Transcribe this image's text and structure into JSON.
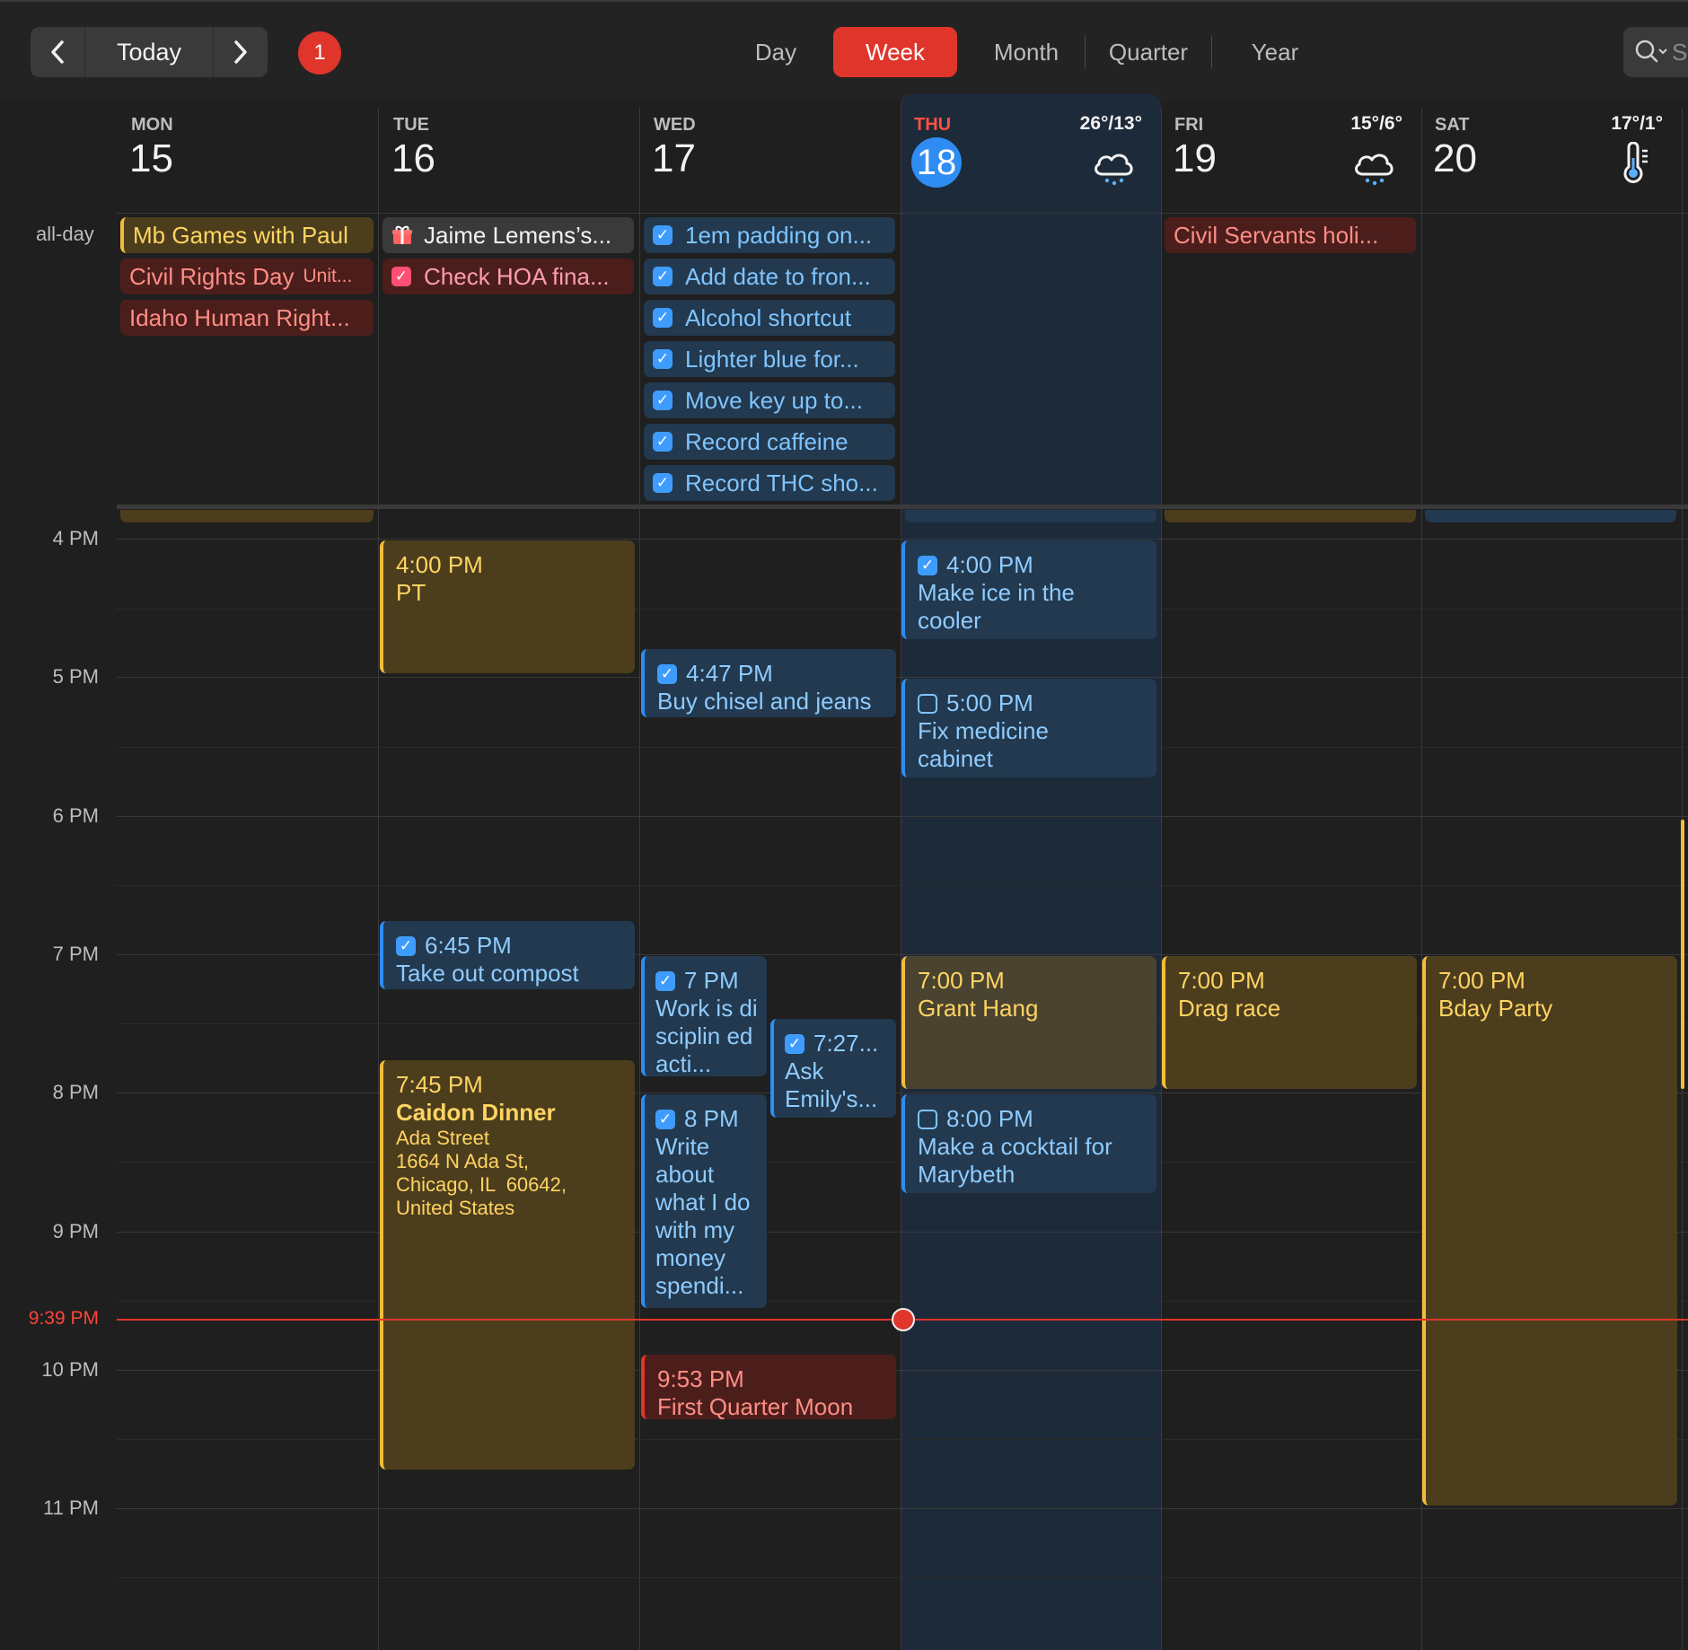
{
  "toolbar": {
    "today_label": "Today",
    "badge_count": "1",
    "views": [
      "Day",
      "Week",
      "Month",
      "Quarter",
      "Year"
    ],
    "active_view": "Week",
    "search_placeholder": "S"
  },
  "days": [
    {
      "dow": "MON",
      "num": "15",
      "temp": ""
    },
    {
      "dow": "TUE",
      "num": "16",
      "temp": ""
    },
    {
      "dow": "WED",
      "num": "17",
      "temp": ""
    },
    {
      "dow": "THU",
      "num": "18",
      "temp": "26°/13°",
      "weather_icon": "cloud-snow-icon"
    },
    {
      "dow": "FRI",
      "num": "19",
      "temp": "15°/6°",
      "weather_icon": "cloud-snow-icon"
    },
    {
      "dow": "SAT",
      "num": "20",
      "temp": "17°/1°",
      "weather_icon": "thermometer-icon"
    }
  ],
  "allday_label": "all-day",
  "allday": {
    "mon": [
      {
        "title": "Mb Games with Paul"
      },
      {
        "title": "Civil Rights Day",
        "sub": "Unit..."
      },
      {
        "title": "Idaho Human Right..."
      }
    ],
    "tue": [
      {
        "title": "Jaime Lemens’s..."
      },
      {
        "title": "Check HOA fina..."
      }
    ],
    "wed": [
      {
        "title": "1em padding on..."
      },
      {
        "title": "Add date to fron..."
      },
      {
        "title": "Alcohol shortcut"
      },
      {
        "title": "Lighter blue for..."
      },
      {
        "title": "Move key up to..."
      },
      {
        "title": "Record caffeine"
      },
      {
        "title": "Record THC sho..."
      }
    ],
    "fri": [
      {
        "title": "Civil Servants holi..."
      }
    ]
  },
  "hours": [
    "4 PM",
    "5 PM",
    "6 PM",
    "7 PM",
    "8 PM",
    "9 PM",
    "10 PM",
    "11 PM"
  ],
  "now_label": "9:39 PM",
  "events": {
    "pt": {
      "time": "4:00 PM",
      "title": "PT"
    },
    "ice": {
      "time": "4:00 PM",
      "title": "Make ice in the cooler"
    },
    "chisel": {
      "time": "4:47 PM",
      "title": "Buy chisel and jeans"
    },
    "medicine": {
      "time": "5:00 PM",
      "title": "Fix medicine cabinet"
    },
    "compost": {
      "time": "6:45 PM",
      "title": "Take out compost"
    },
    "work": {
      "time": "7 PM",
      "title": "Work is disciplin ed acti..."
    },
    "emily": {
      "time": "7:27...",
      "title": "Ask Emily's..."
    },
    "grant": {
      "time": "7:00 PM",
      "title": "Grant Hang"
    },
    "drag": {
      "time": "7:00 PM",
      "title": "Drag race"
    },
    "bday": {
      "time": "7:00 PM",
      "title": "Bday Party"
    },
    "caidon": {
      "time": "7:45 PM",
      "title": "Caidon Dinner",
      "loc": "Ada Street",
      "addr1": "1664 N Ada St,",
      "addr2": "Chicago, IL  60642,",
      "addr3": "United States"
    },
    "write": {
      "time": "8 PM",
      "title": "Write about what I do with my money spendi..."
    },
    "cocktail": {
      "time": "8:00 PM",
      "title": "Make a cocktail for Marybeth"
    },
    "moon": {
      "time": "9:53 PM",
      "title": "First Quarter Moon"
    }
  },
  "colors": {
    "accent_red": "#e0352b",
    "today_blue": "#2f8cf2",
    "event_yellow": "#f2bc3c",
    "reminder_blue": "#3f9cff"
  }
}
